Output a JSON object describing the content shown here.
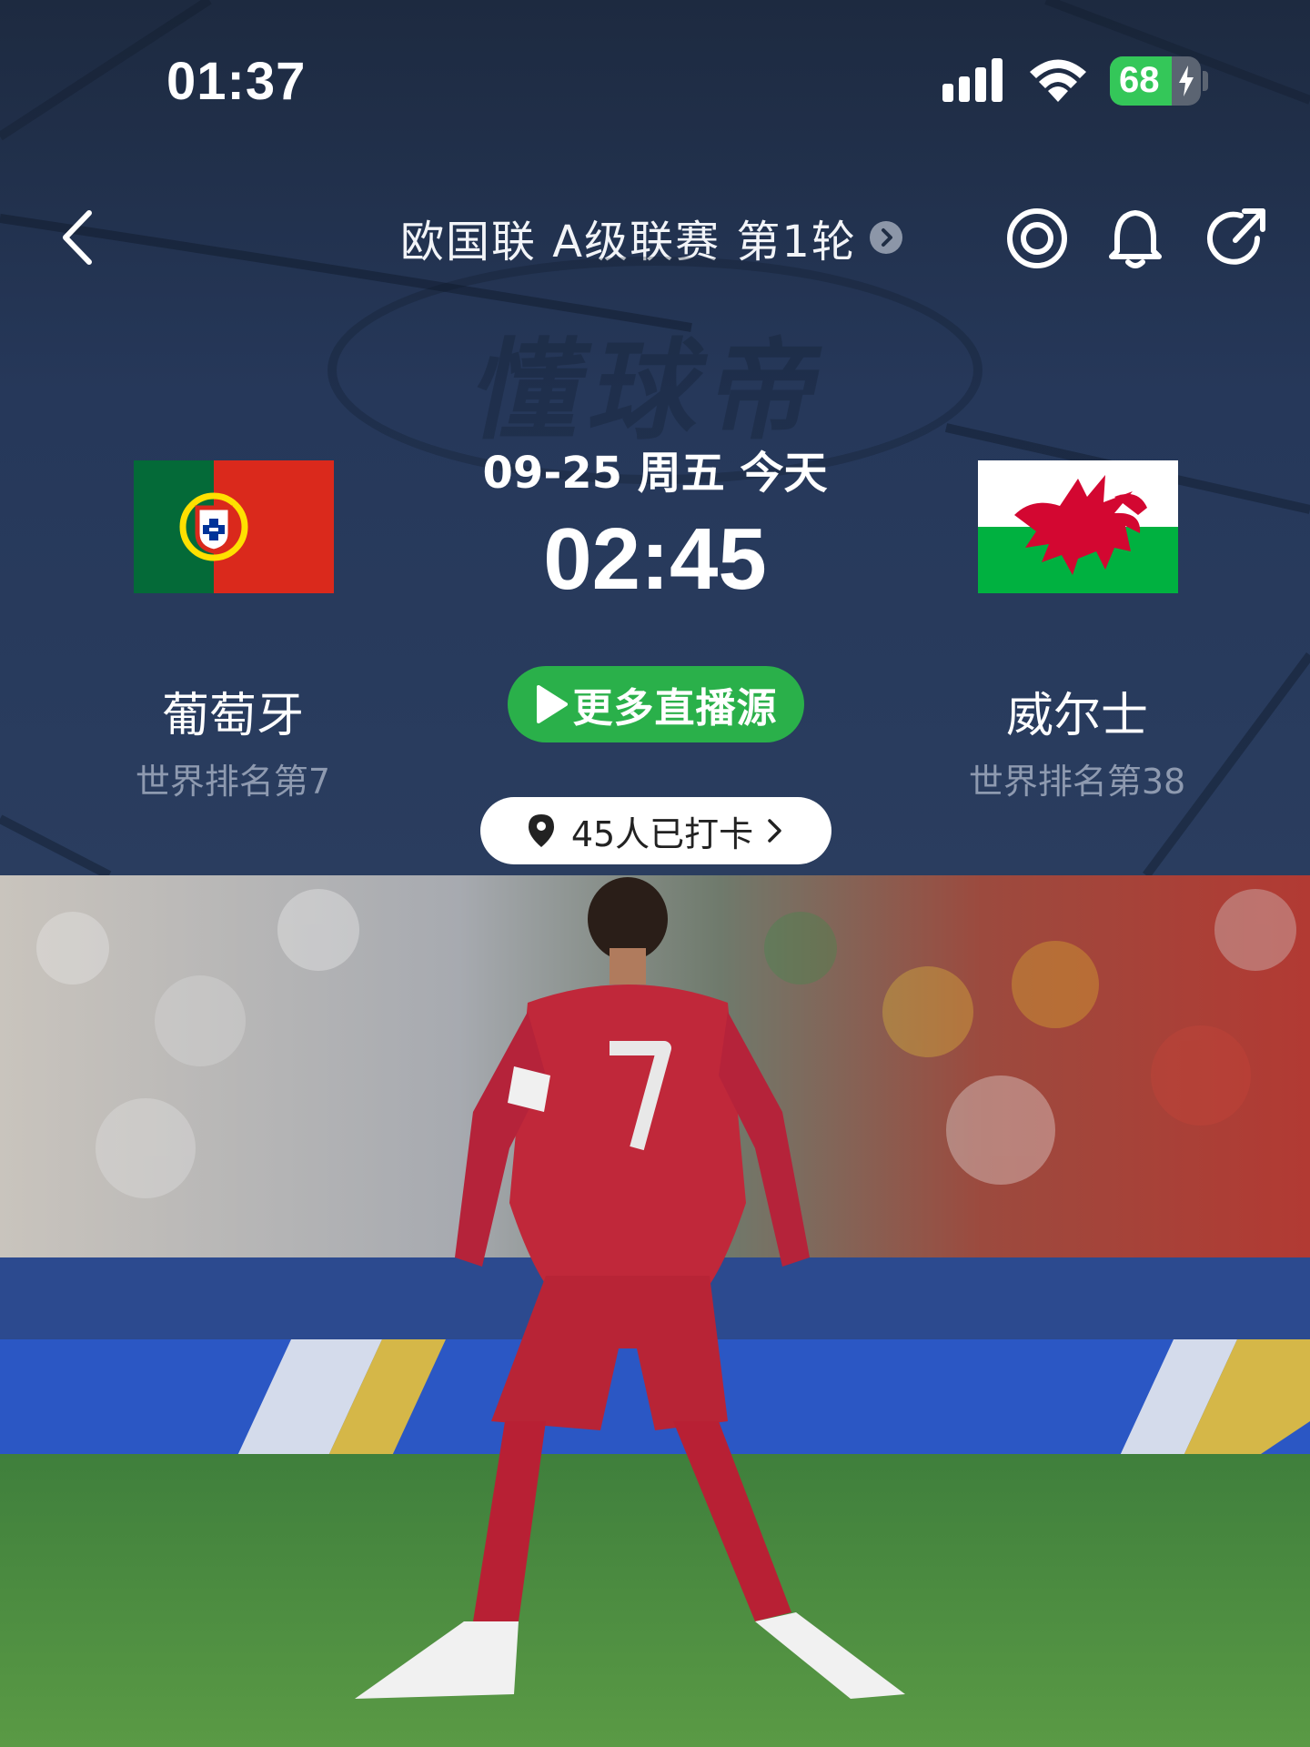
{
  "status_bar": {
    "time": "01:37",
    "battery_level": "68",
    "battery_fraction": 0.68,
    "signal_icon": "cellular-signal-icon",
    "wifi_icon": "wifi-icon",
    "charging_icon": "lightning-bolt-icon"
  },
  "nav": {
    "back_icon": "chevron-left-icon",
    "league_title": "欧国联 A级联赛 第1轮",
    "league_chevron_icon": "chevron-right-circle-icon",
    "actions": [
      "target-icon",
      "bell-icon",
      "share-icon"
    ]
  },
  "watermark": {
    "text": "懂球帝"
  },
  "match": {
    "date": "09-25 周五 今天",
    "time": "02:45",
    "live_button_label": "更多直播源",
    "checkin_label": "45人已打卡"
  },
  "home_team": {
    "name": "葡萄牙",
    "rank": "世界排名第7",
    "flag_colors": {
      "green": "#046a38",
      "red": "#da291c",
      "yellow": "#ffe000"
    }
  },
  "away_team": {
    "name": "威尔士",
    "rank": "世界排名第38",
    "flag_colors": {
      "white": "#ffffff",
      "green": "#00b140",
      "red": "#d30731"
    }
  },
  "colors": {
    "header_bg": "#26385a",
    "accent_green": "#2ab04a",
    "rank_gray": "#8e9ab0"
  }
}
